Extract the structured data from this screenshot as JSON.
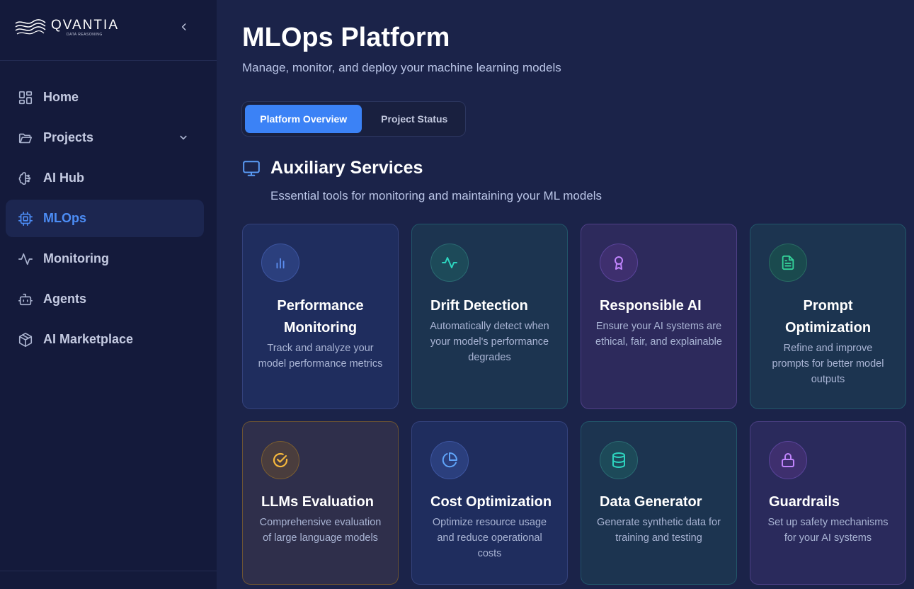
{
  "brand": {
    "name": "QVANTIA",
    "tagline": "DATA REASONING"
  },
  "sidebar": {
    "items": [
      {
        "label": "Home",
        "icon": "layout-grid-icon"
      },
      {
        "label": "Projects",
        "icon": "folder-icon",
        "expandable": true
      },
      {
        "label": "AI Hub",
        "icon": "brain-icon"
      },
      {
        "label": "MLOps",
        "icon": "cpu-icon",
        "active": true
      },
      {
        "label": "Monitoring",
        "icon": "activity-icon"
      },
      {
        "label": "Agents",
        "icon": "bot-icon"
      },
      {
        "label": "AI Marketplace",
        "icon": "package-icon"
      }
    ]
  },
  "header": {
    "title": "MLOps Platform",
    "subtitle": "Manage, monitor, and deploy your machine learning models"
  },
  "tabs": [
    {
      "label": "Platform Overview",
      "active": true
    },
    {
      "label": "Project Status",
      "active": false
    }
  ],
  "section": {
    "title": "Auxiliary Services",
    "subtitle": "Essential tools for monitoring and maintaining your ML models",
    "icon": "monitor-icon"
  },
  "colors": {
    "accent": "#3b82f6",
    "background": "#1b2349",
    "sidebar": "#141a3b"
  },
  "cards": [
    {
      "title": "Performance Monitoring",
      "description": "Track and analyze your model performance metrics",
      "icon": "bar-chart-icon",
      "color": "#5b8def"
    },
    {
      "title": "Drift Detection",
      "description": "Automatically detect when your model's performance degrades",
      "icon": "activity-icon",
      "color": "#2dd4bf"
    },
    {
      "title": "Responsible AI",
      "description": "Ensure your AI systems are ethical, fair, and explainable",
      "icon": "award-icon",
      "color": "#c084fc"
    },
    {
      "title": "Prompt Optimization",
      "description": "Refine and improve prompts for better model outputs",
      "icon": "file-text-icon",
      "color": "#34d399"
    },
    {
      "title": "LLMs Evaluation",
      "description": "Comprehensive evaluation of large language models",
      "icon": "check-circle-icon",
      "color": "#f5b83d"
    },
    {
      "title": "Cost Optimization",
      "description": "Optimize resource usage and reduce operational costs",
      "icon": "pie-chart-icon",
      "color": "#60a5fa"
    },
    {
      "title": "Data Generator",
      "description": "Generate synthetic data for training and testing",
      "icon": "database-icon",
      "color": "#2dd4bf"
    },
    {
      "title": "Guardrails",
      "description": "Set up safety mechanisms for your AI systems",
      "icon": "lock-icon",
      "color": "#c084fc"
    }
  ]
}
